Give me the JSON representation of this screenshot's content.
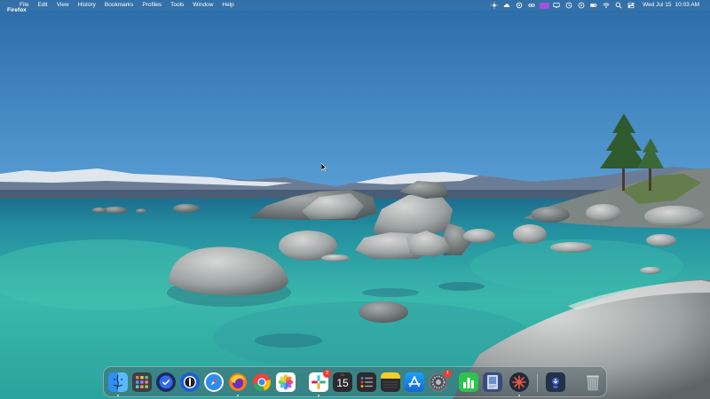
{
  "menubar": {
    "apple_glyph": "",
    "app_name": "Firefox",
    "menus": [
      "File",
      "Edit",
      "View",
      "History",
      "Bookmarks",
      "Profiles",
      "Tools",
      "Window",
      "Help"
    ],
    "status_icons": [
      "brightness-icon",
      "weather-icon",
      "sync-icon",
      "link-icon",
      "vpn-icon",
      "screen-mirror-icon",
      "clock-icon",
      "play-icon",
      "battery-icon",
      "wifi-icon",
      "search-icon",
      "control-center-icon"
    ],
    "date": "Wed Jul 15",
    "time": "10:03 AM"
  },
  "wallpaper": {
    "description_colors": {
      "sky_top": "#2a6ca8",
      "sky_bottom": "#5a9fd4",
      "water_deep": "#1f8aa0",
      "water_shallow": "#39c2b0"
    }
  },
  "dock": {
    "apps": [
      {
        "name": "finder",
        "running": true,
        "badge": null
      },
      {
        "name": "launchpad",
        "running": false,
        "badge": null
      },
      {
        "name": "things",
        "running": false,
        "badge": null
      },
      {
        "name": "1password",
        "running": false,
        "badge": null
      },
      {
        "name": "safari",
        "running": false,
        "badge": null
      },
      {
        "name": "firefox",
        "running": true,
        "badge": null
      },
      {
        "name": "chrome",
        "running": false,
        "badge": null
      },
      {
        "name": "photos",
        "running": false,
        "badge": null
      },
      {
        "name": "slack",
        "running": true,
        "badge": "2"
      },
      {
        "name": "calendar",
        "running": false,
        "badge": null,
        "month": "JUL",
        "day": "15"
      },
      {
        "name": "reminders",
        "running": false,
        "badge": null
      },
      {
        "name": "notes",
        "running": false,
        "badge": null
      },
      {
        "name": "app-store",
        "running": false,
        "badge": null
      },
      {
        "name": "system-settings",
        "running": false,
        "badge": "1"
      },
      {
        "name": "numbers",
        "running": false,
        "badge": null
      },
      {
        "name": "preview",
        "running": false,
        "badge": null
      },
      {
        "name": "spark",
        "running": true,
        "badge": null
      },
      {
        "name": "downloads-stack",
        "running": false,
        "badge": null
      },
      {
        "name": "trash",
        "running": false,
        "badge": null
      }
    ]
  }
}
